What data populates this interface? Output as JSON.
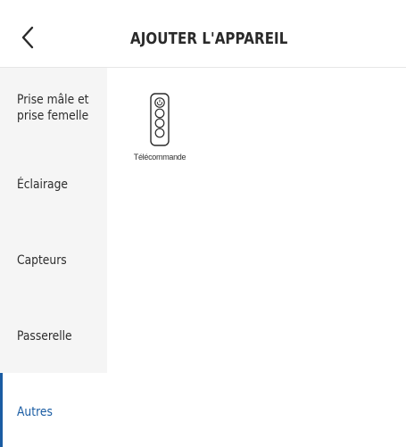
{
  "header": {
    "title": "AJOUTER L'APPAREIL",
    "back_icon": "chevron-left-icon"
  },
  "sidebar": {
    "items": [
      {
        "id": "prise",
        "lines": [
          "Prise mâle et",
          "prise femelle"
        ],
        "active": false
      },
      {
        "id": "eclairage",
        "label": "Éclairage",
        "active": false
      },
      {
        "id": "capteurs",
        "label": "Capteurs",
        "active": false
      },
      {
        "id": "passerelle",
        "label": "Passerelle",
        "active": false
      },
      {
        "id": "autres",
        "label": "Autres",
        "active": true
      }
    ]
  },
  "devices": [
    {
      "label": "Télécommande",
      "icon": "remote-control-icon"
    }
  ],
  "colors": {
    "accent": "#1a5ca3",
    "sidebar_bg": "#f5f5f5",
    "text": "#2d2d2d",
    "divider": "#e6e6e6"
  }
}
